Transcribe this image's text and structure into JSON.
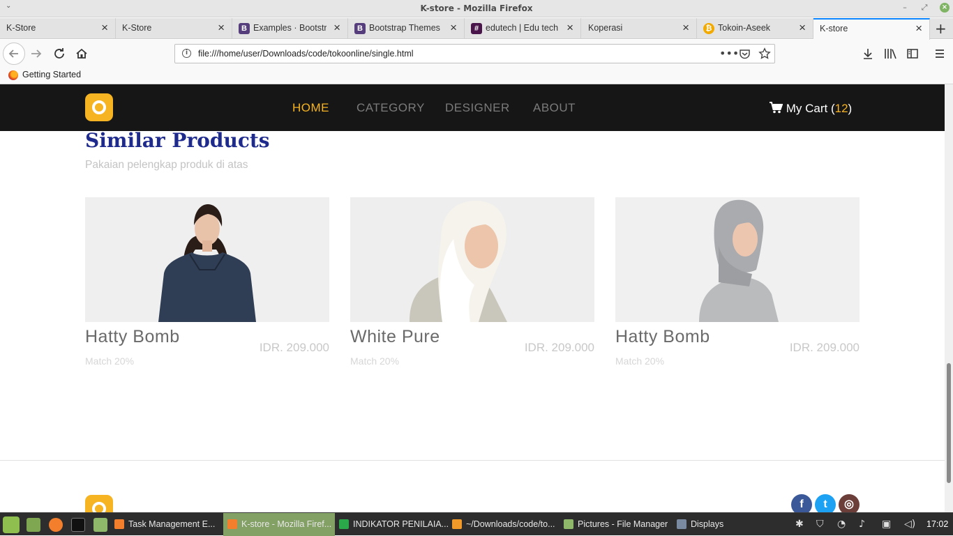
{
  "window": {
    "title": "K-store - Mozilla Firefox",
    "controls": {
      "minimize": "–",
      "maximize": "⤢",
      "close": "×"
    }
  },
  "tabs": [
    {
      "label": "K-Store",
      "icon": ""
    },
    {
      "label": "K-Store",
      "icon": ""
    },
    {
      "label": "Examples · Bootstr",
      "icon": "bootstrap-icon",
      "icon_text": "B",
      "icon_color": "#563d7c"
    },
    {
      "label": "Bootstrap Themes",
      "icon": "bootstrap-icon",
      "icon_text": "B",
      "icon_color": "#563d7c"
    },
    {
      "label": "edutech | Edu tech",
      "icon": "slack-icon",
      "icon_text": "#",
      "icon_color": "#4a154b"
    },
    {
      "label": "Koperasi",
      "icon": ""
    },
    {
      "label": "Tokoin-Aseek",
      "icon": "bitcoin-icon",
      "icon_text": "₿",
      "icon_color": "#f2a900"
    },
    {
      "label": "K-store",
      "icon": "",
      "active": true
    }
  ],
  "nav": {
    "url": "file:///home/user/Downloads/code/tokoonline/single.html"
  },
  "bookmarks": [
    {
      "label": "Getting Started"
    }
  ],
  "site": {
    "menu": [
      {
        "label": "HOME",
        "active": true
      },
      {
        "label": "CATEGORY",
        "active": false
      },
      {
        "label": "DESIGNER",
        "active": false
      },
      {
        "label": "ABOUT",
        "active": false
      }
    ],
    "cart_label": "My Cart (",
    "cart_count": "12",
    "cart_close": ")",
    "brand_color": "#f6b322"
  },
  "similar": {
    "title": "Similar Products",
    "subtitle": "Pakaian pelengkap produk di atas",
    "products": [
      {
        "name": "Hatty Bomb",
        "price": "IDR. 209.000",
        "match": "Match 20%"
      },
      {
        "name": "White Pure",
        "price": "IDR. 209.000",
        "match": "Match 20%"
      },
      {
        "name": "Hatty Bomb",
        "price": "IDR. 209.000",
        "match": "Match 20%"
      }
    ]
  },
  "footer": {
    "social": [
      {
        "name": "facebook-icon",
        "glyph": "f",
        "color": "#3b5998"
      },
      {
        "name": "twitter-icon",
        "glyph": "t",
        "color": "#1da1f2"
      },
      {
        "name": "instagram-icon",
        "glyph": "◎",
        "color": "#6b3e3a"
      }
    ]
  },
  "taskbar": {
    "items": [
      {
        "label": "Task Management E...",
        "color": "#f37e2c"
      },
      {
        "label": "K-store - Mozilla Firef...",
        "color": "#f37e2c",
        "active": true
      },
      {
        "label": "INDIKATOR PENILAIA...",
        "color": "#2aa84a"
      },
      {
        "label": "~/Downloads/code/to...",
        "color": "#f19a2a"
      },
      {
        "label": "Pictures - File Manager",
        "color": "#8fb86a"
      },
      {
        "label": "Displays",
        "color": "#7a8aa0"
      }
    ],
    "clock": "17:02"
  }
}
